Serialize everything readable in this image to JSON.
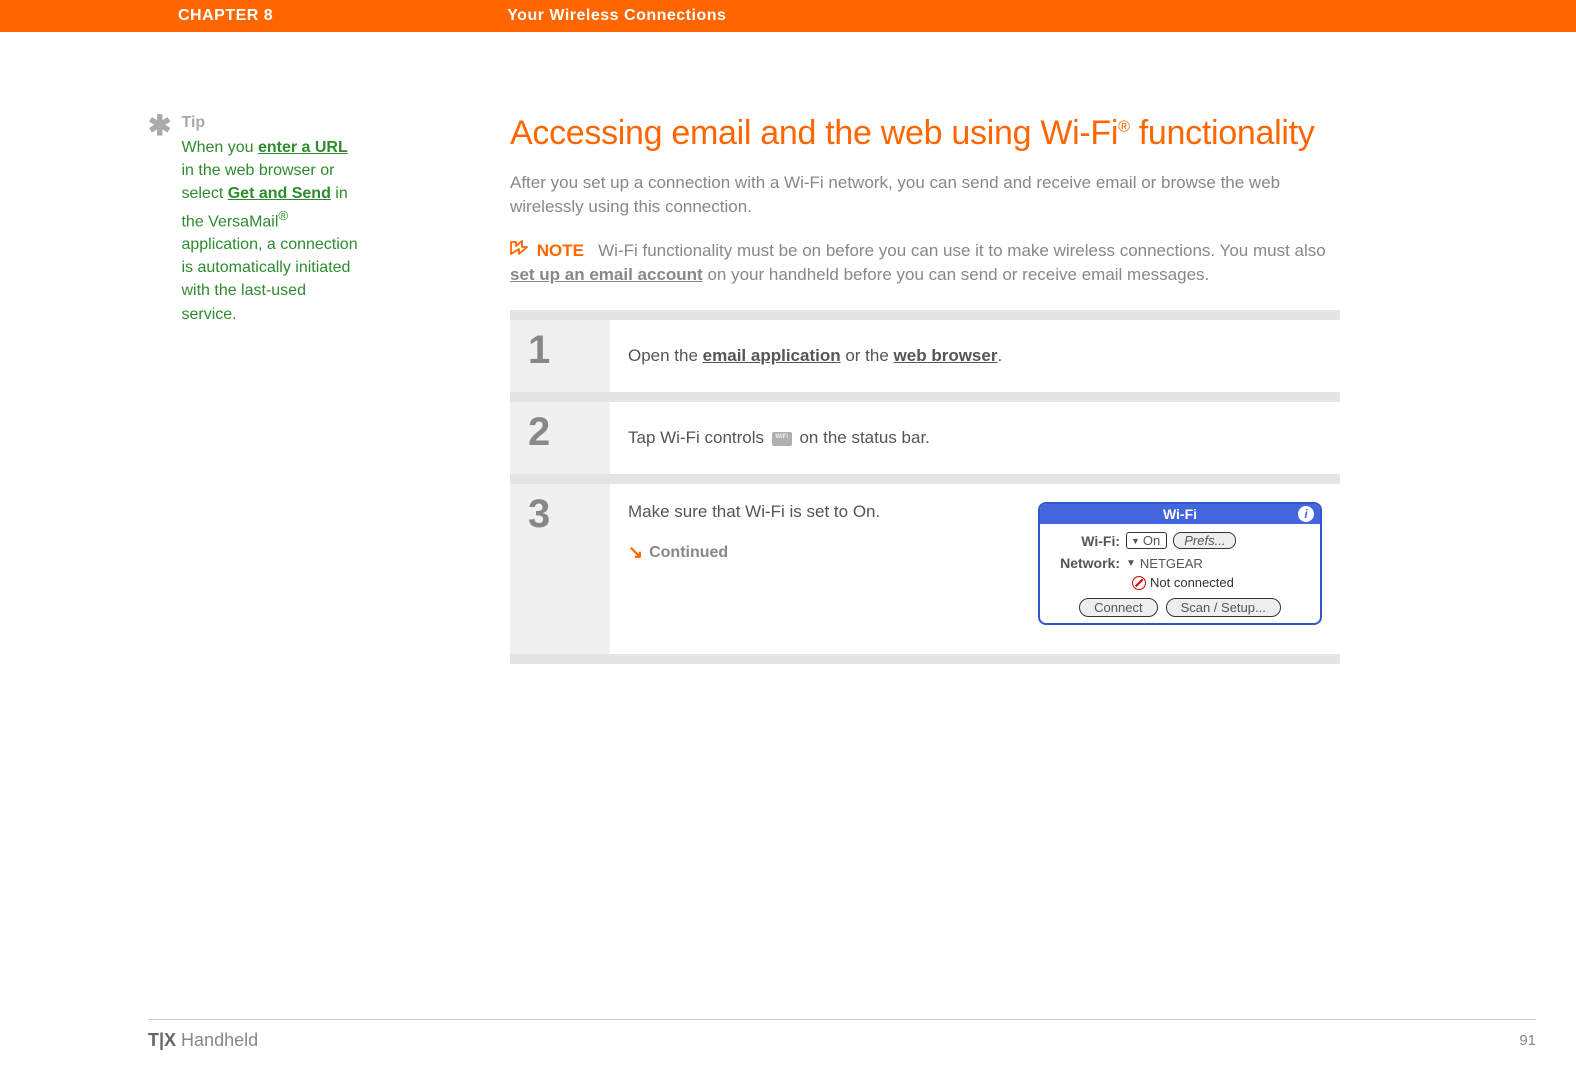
{
  "header": {
    "chapter": "CHAPTER 8",
    "section": "Your Wireless Connections"
  },
  "sidebar": {
    "tip_label": "Tip",
    "tip_part1": "When you ",
    "tip_link1": "enter a URL",
    "tip_part2": " in the web browser or select ",
    "tip_link2": "Get and Send",
    "tip_part3": " in the VersaMail",
    "tip_reg": "®",
    "tip_part4": " application, a connection is automatically initiated with the last-used service."
  },
  "main": {
    "title_part1": "Accessing email and the web using Wi-Fi",
    "title_reg": "®",
    "title_part2": " functionality",
    "intro": "After you set up a connection with a Wi-Fi network, you can send and receive email or browse the web wirelessly using this connection.",
    "note_label": "NOTE",
    "note_part1": "Wi-Fi functionality must be on before you can use it to make wireless connections. You must also ",
    "note_link": "set up an email account",
    "note_part2": " on your handheld before you can send or receive email messages."
  },
  "steps": {
    "s1": {
      "num": "1",
      "text_pre": "Open the ",
      "link1": "email application",
      "text_mid": " or the ",
      "link2": "web browser",
      "text_post": "."
    },
    "s2": {
      "num": "2",
      "text_pre": "Tap Wi-Fi controls ",
      "icon_label": "Wi-Fi",
      "text_post": " on the status bar."
    },
    "s3": {
      "num": "3",
      "text": "Make sure that Wi-Fi is set to On.",
      "continued": "Continued"
    }
  },
  "palm": {
    "title": "Wi-Fi",
    "info": "i",
    "wifi_label": "Wi-Fi:",
    "wifi_value": "On",
    "prefs_btn": "Prefs...",
    "network_label": "Network:",
    "network_value": "NETGEAR",
    "status": "Not connected",
    "connect_btn": "Connect",
    "scan_btn": "Scan / Setup..."
  },
  "footer": {
    "brand_bold": "T|X",
    "brand_rest": " Handheld",
    "page": "91"
  }
}
